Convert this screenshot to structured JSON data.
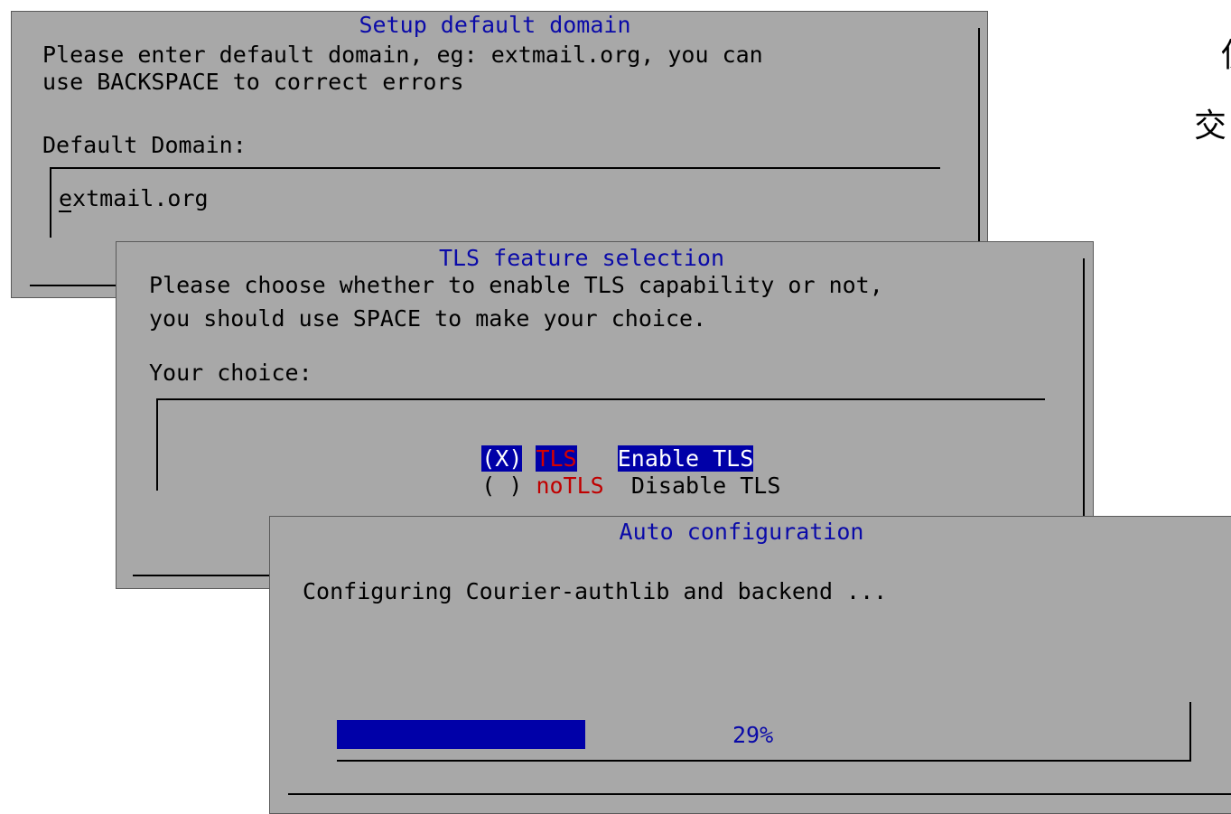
{
  "side_text": {
    "line1": "使",
    "line2": "交"
  },
  "domain_dialog": {
    "title": "Setup default domain",
    "line1": "Please enter default domain, eg: extmail.org, you can",
    "line2": "use BACKSPACE to correct errors",
    "field_label": "Default Domain:",
    "input_value": "extmail.org"
  },
  "tls_dialog": {
    "title": "TLS feature selection",
    "line1": "Please choose whether to enable TLS capability or not,",
    "line2": "you should use SPACE to make your choice.",
    "field_label": "Your choice:",
    "options": [
      {
        "mark": "(X)",
        "key": "TLS",
        "desc": "Enable TLS",
        "selected": true
      },
      {
        "mark": "( )",
        "key": "noTLS",
        "desc": "Disable TLS",
        "selected": false
      }
    ]
  },
  "auto_dialog": {
    "title": "Auto configuration",
    "message": "Configuring Courier-authlib and backend ...",
    "progress_percent": 29,
    "progress_label": "29%"
  },
  "colors": {
    "window_bg": "#a8a8a8",
    "title": "#0a0aa8",
    "selection": "#0000a8",
    "hotkey": "#c00000"
  }
}
